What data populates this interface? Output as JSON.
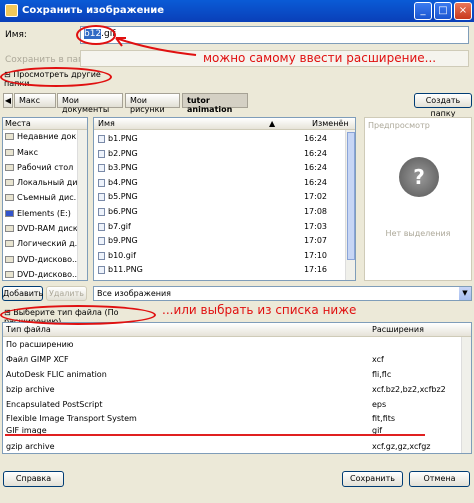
{
  "window": {
    "title": "Сохранить изображение"
  },
  "titlebar_buttons": {
    "minimize": "_",
    "maximize": "□",
    "close": "×"
  },
  "name_field": {
    "label": "Имя:",
    "value_selected": "b12",
    "value_rest": ".gif"
  },
  "save_in": {
    "label": "Сохранить в папке"
  },
  "browse_toggle": {
    "label": "Просмотреть другие папки"
  },
  "path": {
    "back": "◀",
    "items": [
      "Макс",
      "Мои документы",
      "Мои рисунки",
      "tutor animation"
    ]
  },
  "create_folder_label": "Создать папку",
  "places": {
    "header": "Места",
    "items": [
      "Недавние док...",
      "Макс",
      "Рабочий стол",
      "Локальный ди...",
      "Съемный дис...",
      "Elements (E:)",
      "DVD-RAM диско...",
      "Логический д...",
      "DVD-дисково...",
      "DVD-дисково..."
    ]
  },
  "file_list": {
    "col_name": "Имя",
    "col_sort": "▲",
    "col_modified": "Изменён",
    "rows": [
      {
        "name": "b1.PNG",
        "modified": "16:24"
      },
      {
        "name": "b2.PNG",
        "modified": "16:24"
      },
      {
        "name": "b3.PNG",
        "modified": "16:24"
      },
      {
        "name": "b4.PNG",
        "modified": "16:24"
      },
      {
        "name": "b5.PNG",
        "modified": "17:02"
      },
      {
        "name": "b6.PNG",
        "modified": "17:08"
      },
      {
        "name": "b7.gif",
        "modified": "17:03"
      },
      {
        "name": "b9.PNG",
        "modified": "17:07"
      },
      {
        "name": "b10.gif",
        "modified": "17:10"
      },
      {
        "name": "b11.PNG",
        "modified": "17:16"
      }
    ]
  },
  "preview": {
    "label": "Предпросмотр",
    "empty": "Нет выделения"
  },
  "add_button": "Добавить",
  "remove_button": "Удалить",
  "filter": {
    "value": "Все изображения",
    "arrow": "▼"
  },
  "filetype_toggle": {
    "label": "Выберите тип файла (По расширению)"
  },
  "filetype_table": {
    "col_type": "Тип файла",
    "col_ext": "Расширения",
    "rows": [
      {
        "type": "По расширению",
        "ext": ""
      },
      {
        "type": "Файл GIMP XCF",
        "ext": "xcf"
      },
      {
        "type": "AutoDesk FLIC animation",
        "ext": "fli,flc"
      },
      {
        "type": "bzip archive",
        "ext": "xcf.bz2,bz2,xcfbz2"
      },
      {
        "type": "Encapsulated PostScript",
        "ext": "eps"
      },
      {
        "type": "Flexible Image Transport System",
        "ext": "fit,fits"
      },
      {
        "type": "GIF image",
        "ext": "gif"
      },
      {
        "type": "gzip archive",
        "ext": "xcf.gz,gz,xcfgz"
      }
    ]
  },
  "buttons": {
    "help": "Справка",
    "save": "Сохранить",
    "cancel": "Отмена"
  },
  "annotations": {
    "name_hint": "можно самому ввести расширение...",
    "type_hint": "...или выбрать из списка ниже",
    "color": "#e01010"
  }
}
